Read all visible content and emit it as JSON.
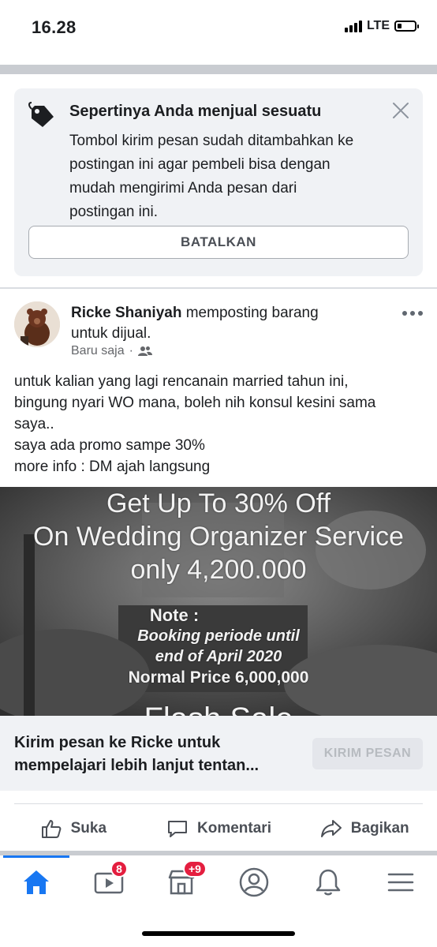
{
  "status_bar": {
    "time": "16.28",
    "network": "LTE"
  },
  "suggestion": {
    "title": "Sepertinya Anda menjual sesuatu",
    "body_lines": [
      "Tombol kirim pesan sudah ditambahkan ke",
      "postingan ini agar pembeli bisa dengan",
      "mudah mengirimi Anda pesan dari",
      "postingan ini."
    ],
    "button": "BATALKAN",
    "icon": "tag-icon"
  },
  "post": {
    "author": "Ricke Shaniyah",
    "action_text_1": "memposting barang",
    "action_text_2": "untuk dijual.",
    "time": "Baru saja",
    "separator": "·",
    "privacy_icon": "friends-icon",
    "text_lines": [
      "untuk kalian yang lagi rencanain married tahun ini,",
      "bingung nyari WO mana, boleh nih konsul kesini sama",
      "saya..",
      "saya ada promo sampe 30%",
      "more info : DM ajah langsung"
    ],
    "image_text": {
      "line1": "Get Up To 30% Off",
      "line2": "On Wedding Organizer Service",
      "line3": "only 4,200.000",
      "line4": "Note :",
      "line5": "Booking periode until",
      "line6": "end of April 2020",
      "line7": "Normal Price 6,000,000",
      "line8": "Flash Sale"
    }
  },
  "cta": {
    "line1": "Kirim pesan ke Ricke untuk",
    "line2": "mempelajari lebih lanjut tentan...",
    "button": "KIRIM PESAN"
  },
  "actions": {
    "like": "Suka",
    "comment": "Komentari",
    "share": "Bagikan"
  },
  "nav": {
    "video_badge": "8",
    "marketplace_badge": "+9",
    "active": "home"
  },
  "colors": {
    "accent": "#1877f2",
    "badge": "#e41e3f",
    "separator": "#c9ccd1"
  }
}
